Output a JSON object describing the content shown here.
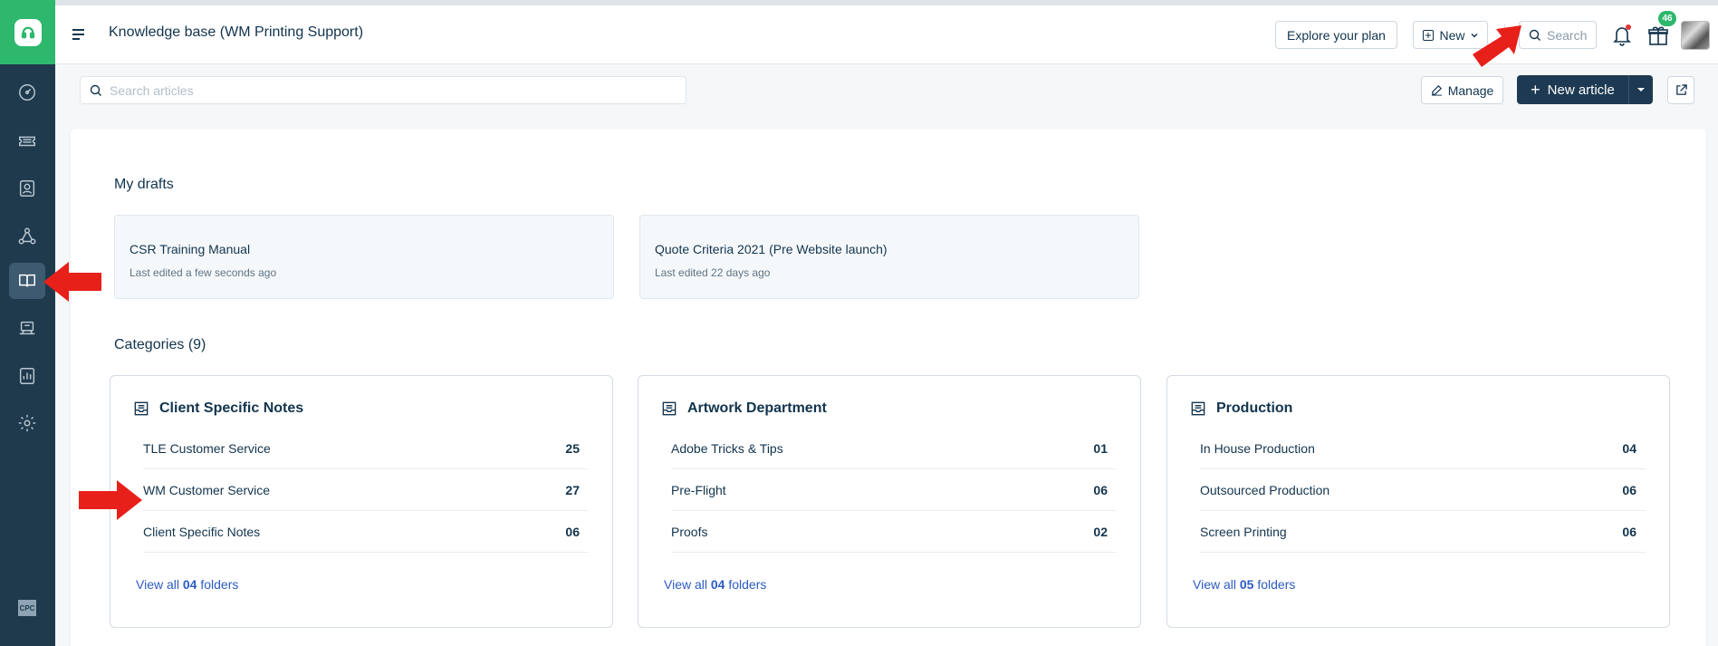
{
  "header": {
    "title": "Knowledge base (WM Printing Support)",
    "explore_label": "Explore your plan",
    "new_label": "New",
    "search_label": "Search",
    "gift_badge": "46",
    "side_badge": "CPC"
  },
  "toolbar": {
    "search_placeholder": "Search articles",
    "manage_label": "Manage",
    "new_article_label": "New article"
  },
  "drafts": {
    "title": "My drafts",
    "items": [
      {
        "title": "CSR Training Manual",
        "subtitle": "Last edited a few seconds ago"
      },
      {
        "title": "Quote Criteria 2021 (Pre Website launch)",
        "subtitle": "Last edited 22 days ago"
      }
    ]
  },
  "categories": {
    "title": "Categories (9)",
    "items": [
      {
        "name": "Client Specific Notes",
        "folders": [
          {
            "name": "TLE Customer Service",
            "count": "25"
          },
          {
            "name": "WM Customer Service",
            "count": "27"
          },
          {
            "name": "Client Specific Notes",
            "count": "06"
          }
        ],
        "view_prefix": "View all",
        "view_count": "04",
        "view_suffix": "folders"
      },
      {
        "name": "Artwork Department",
        "folders": [
          {
            "name": "Adobe Tricks & Tips",
            "count": "01"
          },
          {
            "name": "Pre-Flight",
            "count": "06"
          },
          {
            "name": "Proofs",
            "count": "02"
          }
        ],
        "view_prefix": "View all",
        "view_count": "04",
        "view_suffix": "folders"
      },
      {
        "name": "Production",
        "folders": [
          {
            "name": "In House Production",
            "count": "04"
          },
          {
            "name": "Outsourced Production",
            "count": "06"
          },
          {
            "name": "Screen Printing",
            "count": "06"
          }
        ],
        "view_prefix": "View all",
        "view_count": "05",
        "view_suffix": "folders"
      }
    ]
  },
  "colors": {
    "sidebar": "#1f3a4d",
    "brand": "#2db86d",
    "primary_button": "#1d3a52",
    "link": "#2c5cc5",
    "annotation_arrow": "#e8201a"
  },
  "icons": {
    "sidebar": [
      "dashboard-icon",
      "tickets-icon",
      "contacts-icon",
      "groups-icon",
      "knowledge-base-icon",
      "forums-icon",
      "reports-icon",
      "settings-icon"
    ]
  }
}
